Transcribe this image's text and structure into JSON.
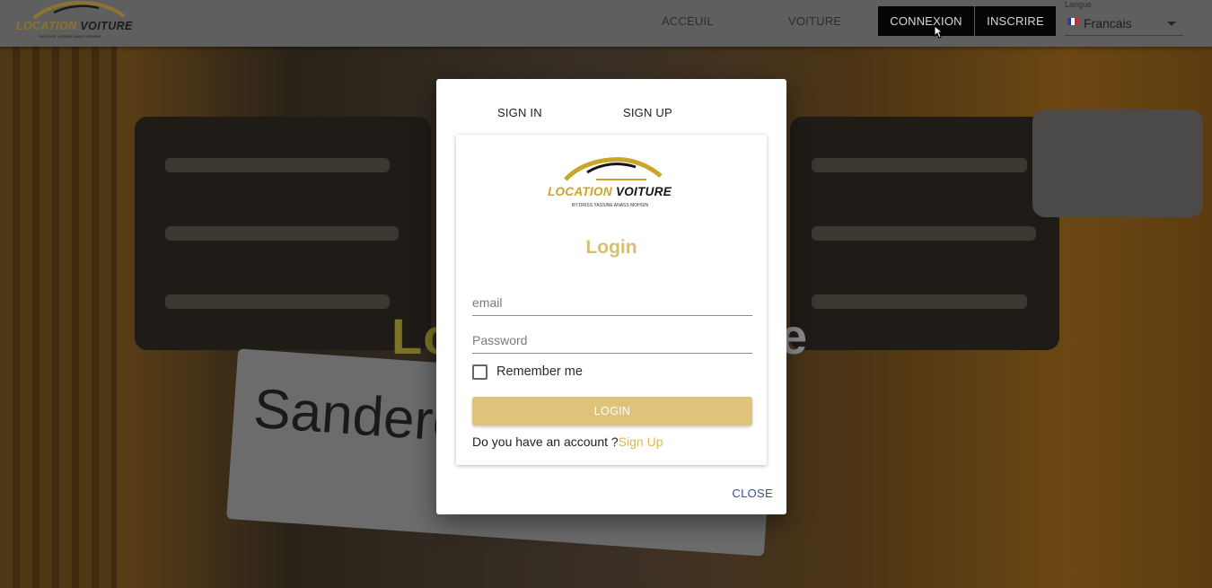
{
  "brand": {
    "name_gold": "LOCATION",
    "name_dark": "VOITURE",
    "tagline": "BY:DRISS YASSINE ANASS MOHSIN"
  },
  "nav": {
    "links": [
      "ACCEUIL",
      "VOITURE"
    ],
    "buttons": [
      "CONNEXION",
      "INSCRIRE"
    ],
    "language": {
      "label": "Langue",
      "value": "Francais",
      "flag": "fr-flag-icon"
    }
  },
  "hero": {
    "title_start": "Lo",
    "title_end": "e",
    "plate_text": "Sandero"
  },
  "modal": {
    "tabs": [
      "SIGN IN",
      "SIGN UP"
    ],
    "title": "Login",
    "email_placeholder": "email",
    "password_placeholder": "Password",
    "remember_label": "Remember me",
    "login_label": "LOGIN",
    "account_question": "Do you have an account ?",
    "signup_link": "Sign Up",
    "close_label": "CLOSE"
  },
  "colors": {
    "gold": "#dfc37a",
    "title_gold": "#d8bd74",
    "link": "#3e4c9c",
    "nav_button_bg": "#050505"
  }
}
